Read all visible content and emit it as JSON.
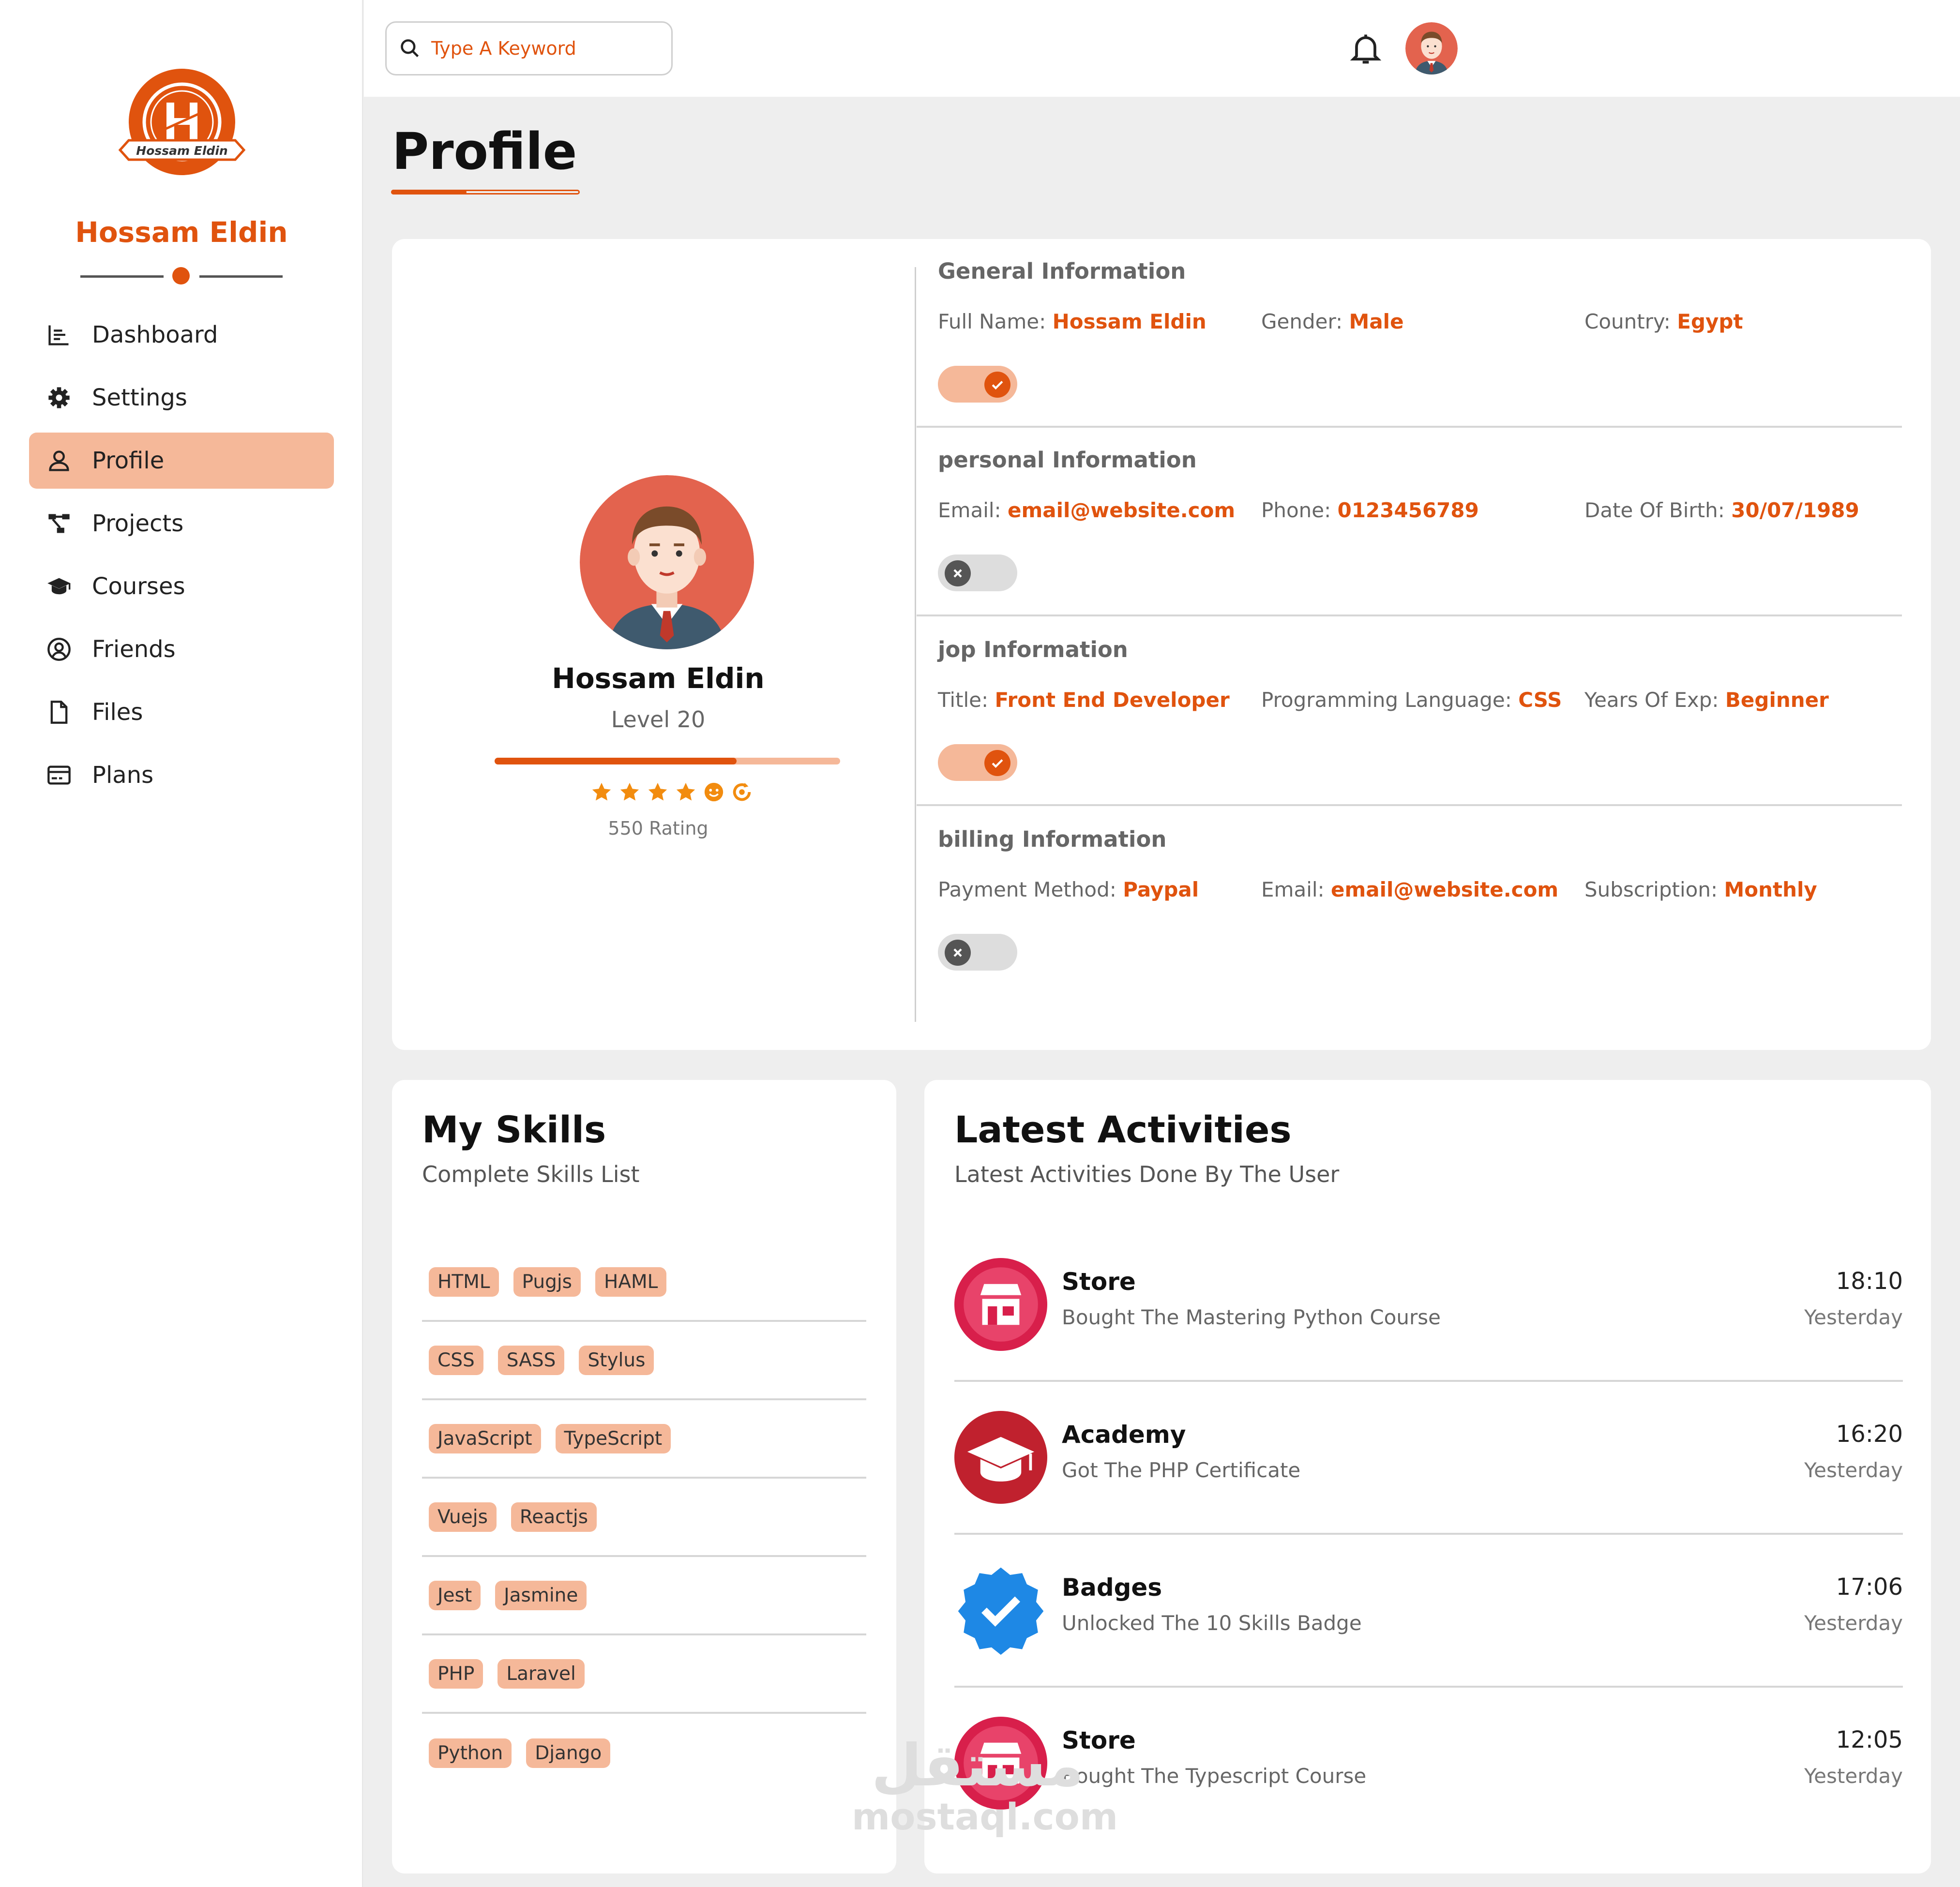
{
  "brand": {
    "name": "Hossam Eldin",
    "logo_text": "Hossam Eldin",
    "accent_color": "#e0530e",
    "accent_light": "#f5b899"
  },
  "sidebar": {
    "items": [
      {
        "label": "Dashboard",
        "icon": "chart-bar-icon",
        "active": false
      },
      {
        "label": "Settings",
        "icon": "gear-icon",
        "active": false
      },
      {
        "label": "Profile",
        "icon": "user-icon",
        "active": true
      },
      {
        "label": "Projects",
        "icon": "diagram-project-icon",
        "active": false
      },
      {
        "label": "Courses",
        "icon": "graduation-cap-icon",
        "active": false
      },
      {
        "label": "Friends",
        "icon": "circle-user-icon",
        "active": false
      },
      {
        "label": "Files",
        "icon": "file-icon",
        "active": false
      },
      {
        "label": "Plans",
        "icon": "credit-card-icon",
        "active": false
      }
    ]
  },
  "topbar": {
    "search_placeholder": "Type A Keyword",
    "search_icon": "search-icon",
    "bell_icon": "bell-icon",
    "avatar_icon": "user-avatar"
  },
  "page": {
    "title": "Profile"
  },
  "profile": {
    "name": "Hossam Eldin",
    "level": "Level 20",
    "level_progress": 0.7,
    "rating": "550 Rating",
    "rating_icons": [
      "star-icon",
      "star-icon",
      "star-icon",
      "star-icon",
      "smile-icon",
      "rotate-icon"
    ],
    "sections": [
      {
        "title": "General Information",
        "fields": [
          {
            "label": "Full Name: ",
            "value": "Hossam Eldin"
          },
          {
            "label": "Gender: ",
            "value": "Male"
          },
          {
            "label": "Country: ",
            "value": "Egypt"
          }
        ],
        "toggle": true
      },
      {
        "title": "personal Information",
        "fields": [
          {
            "label": "Email: ",
            "value": "email@website.com"
          },
          {
            "label": "Phone: ",
            "value": "0123456789"
          },
          {
            "label": "Date Of Birth: ",
            "value": "30/07/1989"
          }
        ],
        "toggle": false
      },
      {
        "title": "jop Information",
        "fields": [
          {
            "label": "Title: ",
            "value": "Front End Developer"
          },
          {
            "label": "Programming Language: ",
            "value": "CSS"
          },
          {
            "label": "Years Of Exp: ",
            "value": "Beginner"
          }
        ],
        "toggle": true
      },
      {
        "title": "billing Information",
        "fields": [
          {
            "label": "Payment Method: ",
            "value": "Paypal"
          },
          {
            "label": "Email: ",
            "value": "email@website.com"
          },
          {
            "label": "Subscription: ",
            "value": "Monthly"
          }
        ],
        "toggle": false
      }
    ]
  },
  "skills": {
    "title": "My Skills",
    "subtitle": "Complete Skills List",
    "rows": [
      [
        "HTML",
        "Pugjs",
        "HAML"
      ],
      [
        "CSS",
        "SASS",
        "Stylus"
      ],
      [
        "JavaScript",
        "TypeScript"
      ],
      [
        "Vuejs",
        "Reactjs"
      ],
      [
        "Jest",
        "Jasmine"
      ],
      [
        "PHP",
        "Laravel"
      ],
      [
        "Python",
        "Django"
      ]
    ]
  },
  "activities": {
    "title": "Latest Activities",
    "subtitle": "Latest Activities Done By The User",
    "items": [
      {
        "title": "Store",
        "desc": "Bought The Mastering Python Course",
        "time": "18:10",
        "day": "Yesterday",
        "icon": "store-icon",
        "color": "#d81f4b"
      },
      {
        "title": "Academy",
        "desc": "Got The PHP Certificate",
        "time": "16:20",
        "day": "Yesterday",
        "icon": "graduation-cap-icon",
        "color": "#c0212e"
      },
      {
        "title": "Badges",
        "desc": "Unlocked The 10 Skills Badge",
        "time": "17:06",
        "day": "Yesterday",
        "icon": "verified-badge-icon",
        "color": "#1e88e5"
      },
      {
        "title": "Store",
        "desc": "Bought The Typescript Course",
        "time": "12:05",
        "day": "Yesterday",
        "icon": "store-icon",
        "color": "#d81f4b"
      }
    ]
  },
  "watermark": {
    "arabic": "مستقل",
    "latin": "mostaql.com"
  }
}
